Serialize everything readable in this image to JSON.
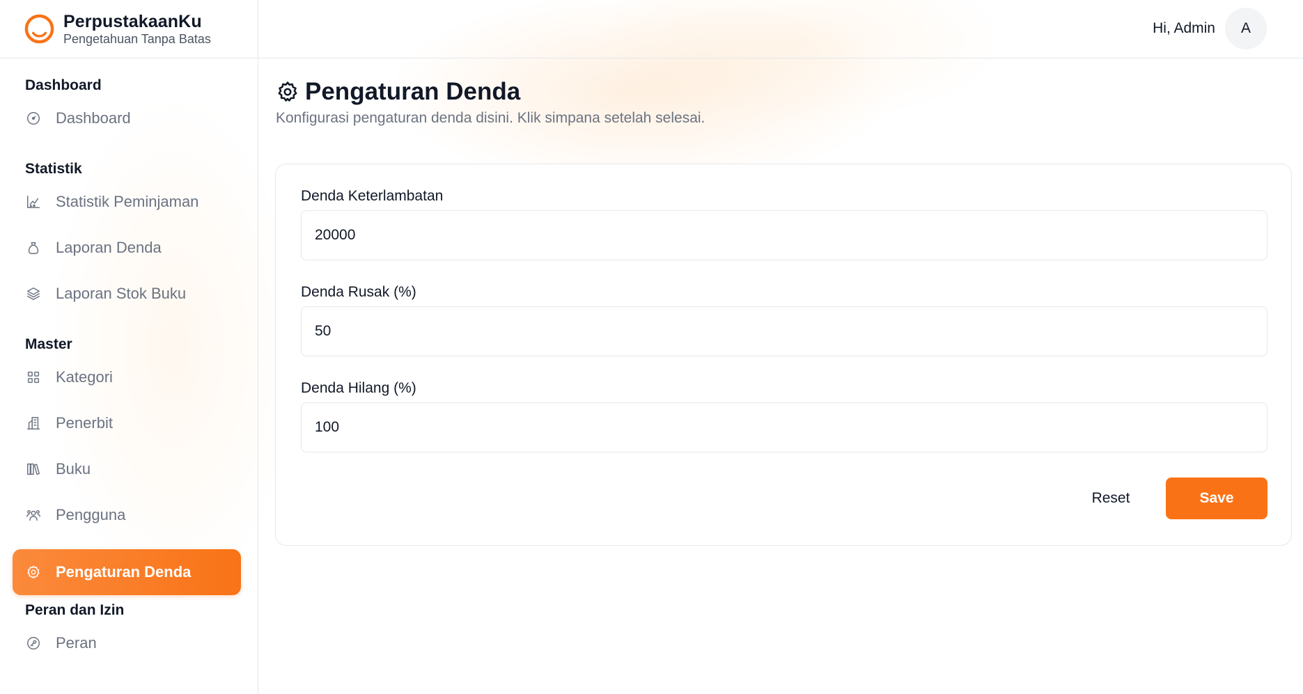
{
  "brand": {
    "name": "PerpustakaanKu",
    "tagline": "Pengetahuan Tanpa Batas",
    "accent_color": "#f97316"
  },
  "header": {
    "greeting": "Hi, Admin",
    "avatar_initial": "A"
  },
  "sidebar": {
    "sections": [
      {
        "title": "Dashboard",
        "items": [
          {
            "label": "Dashboard",
            "icon": "gauge-icon"
          }
        ]
      },
      {
        "title": "Statistik",
        "items": [
          {
            "label": "Statistik Peminjaman",
            "icon": "chart-icon"
          },
          {
            "label": "Laporan Denda",
            "icon": "money-bag-icon"
          },
          {
            "label": "Laporan Stok Buku",
            "icon": "stack-icon"
          }
        ]
      },
      {
        "title": "Master",
        "items": [
          {
            "label": "Kategori",
            "icon": "grid-icon"
          },
          {
            "label": "Penerbit",
            "icon": "building-icon"
          },
          {
            "label": "Buku",
            "icon": "books-icon"
          },
          {
            "label": "Pengguna",
            "icon": "users-icon"
          },
          {
            "label": "Pengaturan Denda",
            "icon": "gear-icon",
            "active": true
          }
        ]
      },
      {
        "title": "Peran dan Izin",
        "items": [
          {
            "label": "Peran",
            "icon": "key-circle-icon"
          }
        ]
      }
    ]
  },
  "main": {
    "title": "Pengaturan Denda",
    "title_icon": "gear-icon",
    "subtitle": "Konfigurasi pengaturan denda disini. Klik simpana setelah selesai.",
    "form": {
      "fields": [
        {
          "label": "Denda Keterlambatan",
          "value": "20000"
        },
        {
          "label": "Denda Rusak (%)",
          "value": "50"
        },
        {
          "label": "Denda Hilang (%)",
          "value": "100"
        }
      ],
      "reset_label": "Reset",
      "save_label": "Save"
    }
  }
}
